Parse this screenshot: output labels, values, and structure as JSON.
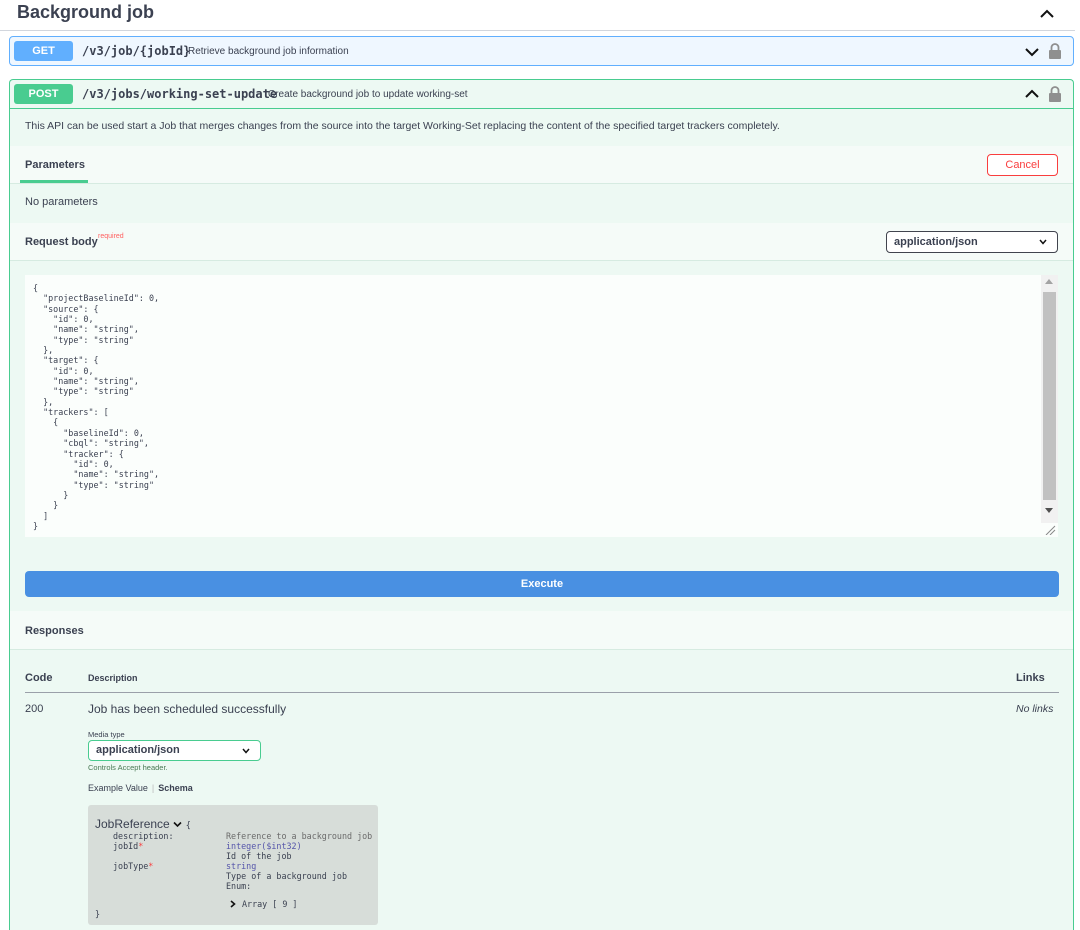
{
  "section": {
    "title": "Background job"
  },
  "get_op": {
    "method": "GET",
    "path": "/v3/job/{jobId}",
    "summary": "Retrieve background job information"
  },
  "post_op": {
    "method": "POST",
    "path": "/v3/jobs/working-set-update",
    "summary": "Create background job to update working-set",
    "description": "This API can be used start a Job that merges changes from the source into the target Working-Set replacing the content of the specified target trackers completely.",
    "params_tab": "Parameters",
    "cancel_label": "Cancel",
    "no_params": "No parameters",
    "request_body_label": "Request body",
    "required_label": "required",
    "content_type": "application/json",
    "body_json": "{\n  \"projectBaselineId\": 0,\n  \"source\": {\n    \"id\": 0,\n    \"name\": \"string\",\n    \"type\": \"string\"\n  },\n  \"target\": {\n    \"id\": 0,\n    \"name\": \"string\",\n    \"type\": \"string\"\n  },\n  \"trackers\": [\n    {\n      \"baselineId\": 0,\n      \"cbql\": \"string\",\n      \"tracker\": {\n        \"id\": 0,\n        \"name\": \"string\",\n        \"type\": \"string\"\n      }\n    }\n  ]\n}",
    "execute_label": "Execute"
  },
  "responses": {
    "label": "Responses",
    "headers": {
      "code": "Code",
      "description": "Description",
      "links": "Links"
    },
    "rows": [
      {
        "code": "200",
        "description": "Job has been scheduled successfully",
        "links": "No links",
        "media_type_label": "Media type",
        "media_type": "application/json",
        "controls_note": "Controls Accept header.",
        "tab_example": "Example Value",
        "tab_schema": "Schema"
      }
    ]
  },
  "schema": {
    "name": "JobReference",
    "open_brace": "{",
    "close_brace": "}",
    "description_key": "description:",
    "description_value": "Reference to a background job",
    "fields": [
      {
        "name": "jobId",
        "type": "integer($int32)",
        "desc": "Id of the job"
      },
      {
        "name": "jobType",
        "type": "string",
        "desc": "Type of a background job"
      }
    ],
    "enum_label": "Enum:",
    "array_label": "Array [ 9 ]"
  },
  "colors": {
    "get": "#61affe",
    "post": "#49cc90",
    "execute": "#4990e2",
    "cancel": "#f93e3e",
    "required": "#ff6060"
  },
  "icons": [
    "chevron-up-icon",
    "chevron-down-icon",
    "lock-icon",
    "select-arrow-icon",
    "resize-grip-icon"
  ]
}
